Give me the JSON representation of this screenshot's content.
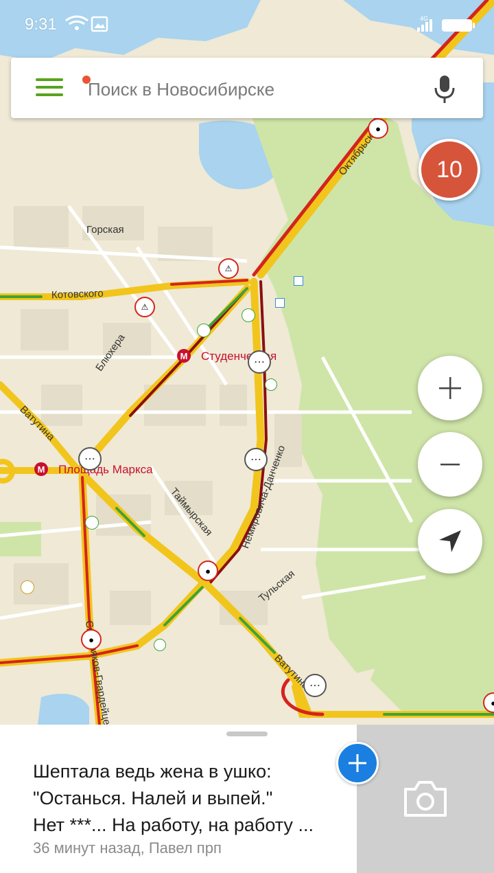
{
  "status_bar": {
    "time": "9:31",
    "network": "4G"
  },
  "search": {
    "placeholder": "Поиск в Новосибирске"
  },
  "traffic": {
    "score": "10",
    "color": "#d6543a"
  },
  "map": {
    "streets": {
      "gorskaya": "Горская",
      "kotovskogo": "Котовского",
      "bluhera": "Блюхера",
      "vatutina": "Ватутина",
      "vatutina2": "Ватутина",
      "taimyrskaya": "Таймырская",
      "nemirovicha": "Немировича-Данченко",
      "tulskaya": "Тульская",
      "oktyabrskaya": "Октябрьская",
      "sibiryakov": "Сибиряков-Гвардейцев"
    },
    "metro": {
      "studencheskaya": "Студенческая",
      "ploshad_marksa": "Площадь Маркса"
    },
    "traffic_colors": {
      "jam": "#d4241c",
      "slow": "#f2c51c",
      "free": "#3fa334",
      "heavy": "#8b0f0f"
    }
  },
  "controls": {
    "zoom_in": "+",
    "zoom_out": "−"
  },
  "story": {
    "lines": [
      "Шептала ведь жена в ушко:",
      "\"Останься. Налей и выпей.\"",
      "Нет ***... На работу, на работу ..."
    ],
    "meta": "36 минут назад, Павел прп"
  },
  "icons": {
    "menu": "menu-icon",
    "mic": "mic-icon",
    "camera": "camera-icon",
    "locate": "arrow-locate-icon",
    "add": "plus-icon"
  },
  "accent": "#58a41a"
}
